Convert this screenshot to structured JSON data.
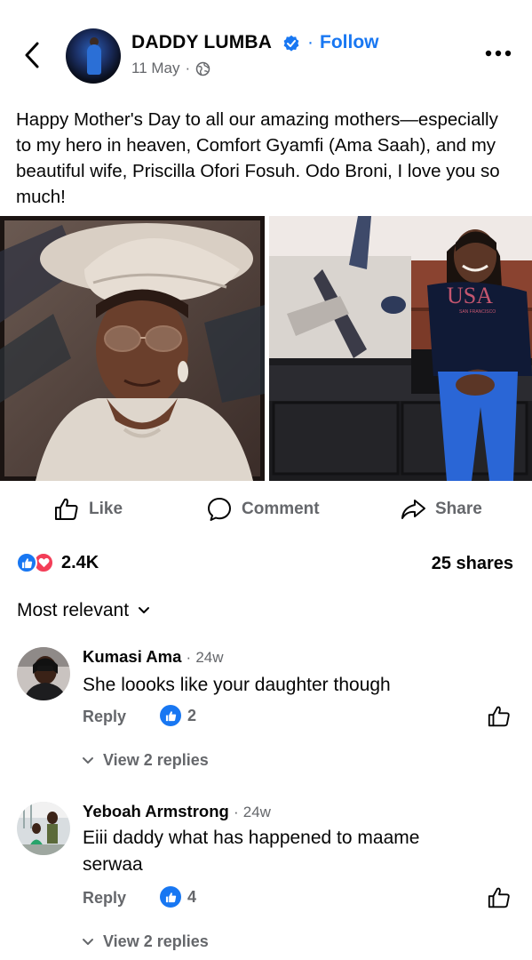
{
  "post": {
    "author": "DADDY LUMBA",
    "follow_label": "Follow",
    "separator": "·",
    "date": "11 May",
    "date_separator": "·",
    "caption": "Happy Mother's Day to all our amazing mothers—especially to my hero in heaven, Comfort Gyamfi (Ama Saah), and my beautiful wife, Priscilla Ofori Fosuh. Odo Broni, I love you so much!",
    "photos": [
      {
        "name": "photo-mother-portrait"
      },
      {
        "name": "photo-wife",
        "shirt_text": "USA",
        "shirt_subtext": "SAN FRANCISCO"
      }
    ]
  },
  "actions": {
    "like": "Like",
    "comment": "Comment",
    "share": "Share"
  },
  "stats": {
    "reaction_count": "2.4K",
    "shares": "25 shares"
  },
  "sort": {
    "label": "Most relevant"
  },
  "comments": [
    {
      "name": "Kumasi Ama",
      "time": "24w",
      "text": "She loooks like your daughter though",
      "reply_label": "Reply",
      "likes": "2",
      "view_replies": "View 2 replies"
    },
    {
      "name": "Yeboah Armstrong",
      "time": "24w",
      "text": "Eiii daddy what has happened to maame serwaa",
      "reply_label": "Reply",
      "likes": "4",
      "view_replies": "View 2 replies"
    }
  ],
  "colors": {
    "accent": "#1877f2",
    "secondary_text": "#65676b",
    "love": "#f33e58"
  },
  "icons": [
    "back-arrow-icon",
    "verified-badge-icon",
    "globe-icon",
    "more-options-icon",
    "like-icon",
    "comment-icon",
    "share-icon",
    "chevron-down-icon"
  ]
}
